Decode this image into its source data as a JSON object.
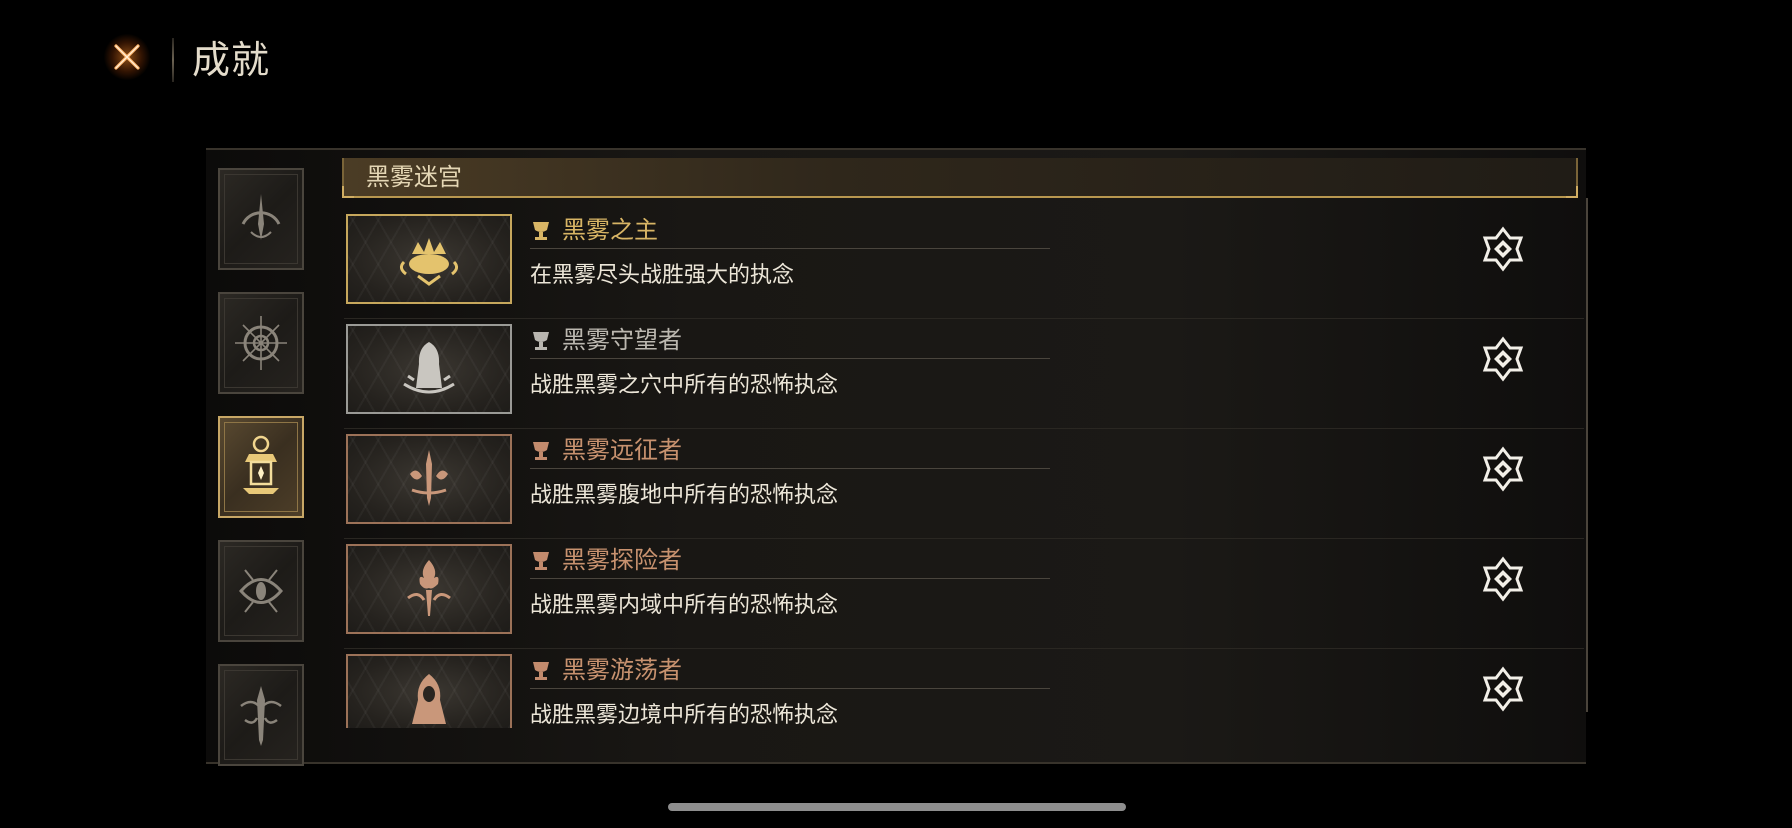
{
  "header": {
    "title": "成就",
    "close_icon": "close-x-icon"
  },
  "colors": {
    "gold": "#c6a75c",
    "silver": "#9a9a96",
    "bronze": "#9c7258",
    "accent_orange": "#e8803a"
  },
  "categories": [
    {
      "icon": "sword-arc-icon",
      "active": false
    },
    {
      "icon": "compass-rune-icon",
      "active": false
    },
    {
      "icon": "lantern-icon",
      "active": true
    },
    {
      "icon": "eye-demon-icon",
      "active": false
    },
    {
      "icon": "dagger-crest-icon",
      "active": false
    }
  ],
  "section": {
    "title": "黑雾迷宫"
  },
  "achievements": [
    {
      "name": "黑雾之主",
      "description": "在黑雾尽头战胜强大的执念",
      "tier": "gold",
      "icon": "crown-crest-icon",
      "status_icon": "completed-emblem-icon"
    },
    {
      "name": "黑雾守望者",
      "description": "战胜黑雾之穴中所有的恐怖执念",
      "tier": "silver",
      "icon": "hooded-figure-icon",
      "status_icon": "completed-emblem-icon"
    },
    {
      "name": "黑雾远征者",
      "description": "战胜黑雾腹地中所有的恐怖执念",
      "tier": "bronze",
      "icon": "sword-flame-icon",
      "status_icon": "completed-emblem-icon"
    },
    {
      "name": "黑雾探险者",
      "description": "战胜黑雾内域中所有的恐怖执念",
      "tier": "bronze",
      "icon": "torch-fire-icon",
      "status_icon": "completed-emblem-icon"
    },
    {
      "name": "黑雾游荡者",
      "description": "战胜黑雾边境中所有的恐怖执念",
      "tier": "bronze",
      "icon": "cloaked-wanderer-icon",
      "status_icon": "completed-emblem-icon"
    }
  ]
}
